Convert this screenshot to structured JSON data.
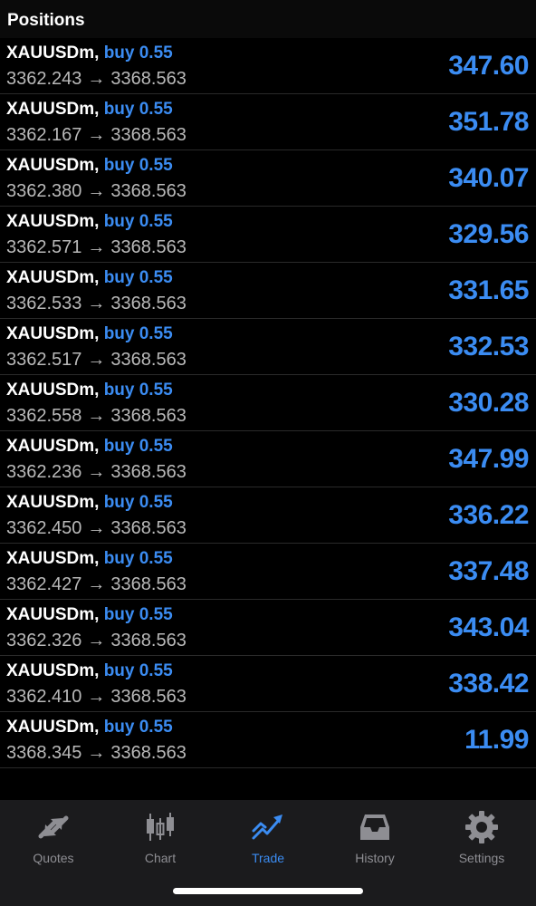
{
  "header": {
    "title": "Positions"
  },
  "positions": [
    {
      "symbol": "XAUUSDm",
      "side": "buy 0.55",
      "open_price": "3362.243",
      "arrow": "→",
      "current_price": "3368.563",
      "profit": "347.60"
    },
    {
      "symbol": "XAUUSDm",
      "side": "buy 0.55",
      "open_price": "3362.167",
      "arrow": "→",
      "current_price": "3368.563",
      "profit": "351.78"
    },
    {
      "symbol": "XAUUSDm",
      "side": "buy 0.55",
      "open_price": "3362.380",
      "arrow": "→",
      "current_price": "3368.563",
      "profit": "340.07"
    },
    {
      "symbol": "XAUUSDm",
      "side": "buy 0.55",
      "open_price": "3362.571",
      "arrow": "→",
      "current_price": "3368.563",
      "profit": "329.56"
    },
    {
      "symbol": "XAUUSDm",
      "side": "buy 0.55",
      "open_price": "3362.533",
      "arrow": "→",
      "current_price": "3368.563",
      "profit": "331.65"
    },
    {
      "symbol": "XAUUSDm",
      "side": "buy 0.55",
      "open_price": "3362.517",
      "arrow": "→",
      "current_price": "3368.563",
      "profit": "332.53"
    },
    {
      "symbol": "XAUUSDm",
      "side": "buy 0.55",
      "open_price": "3362.558",
      "arrow": "→",
      "current_price": "3368.563",
      "profit": "330.28"
    },
    {
      "symbol": "XAUUSDm",
      "side": "buy 0.55",
      "open_price": "3362.236",
      "arrow": "→",
      "current_price": "3368.563",
      "profit": "347.99"
    },
    {
      "symbol": "XAUUSDm",
      "side": "buy 0.55",
      "open_price": "3362.450",
      "arrow": "→",
      "current_price": "3368.563",
      "profit": "336.22"
    },
    {
      "symbol": "XAUUSDm",
      "side": "buy 0.55",
      "open_price": "3362.427",
      "arrow": "→",
      "current_price": "3368.563",
      "profit": "337.48"
    },
    {
      "symbol": "XAUUSDm",
      "side": "buy 0.55",
      "open_price": "3362.326",
      "arrow": "→",
      "current_price": "3368.563",
      "profit": "343.04"
    },
    {
      "symbol": "XAUUSDm",
      "side": "buy 0.55",
      "open_price": "3362.410",
      "arrow": "→",
      "current_price": "3368.563",
      "profit": "338.42"
    },
    {
      "symbol": "XAUUSDm",
      "side": "buy 0.55",
      "open_price": "3368.345",
      "arrow": "→",
      "current_price": "3368.563",
      "profit": "11.99"
    }
  ],
  "tabs": [
    {
      "label": "Quotes",
      "icon": "quotes-icon",
      "active": false
    },
    {
      "label": "Chart",
      "icon": "chart-candles-icon",
      "active": false
    },
    {
      "label": "Trade",
      "icon": "trade-trend-icon",
      "active": true
    },
    {
      "label": "History",
      "icon": "history-inbox-icon",
      "active": false
    },
    {
      "label": "Settings",
      "icon": "gear-icon",
      "active": false
    }
  ],
  "colors": {
    "accent": "#3b8cf2",
    "background": "#000000",
    "secondary_text": "#b9b9b9",
    "tab_bar": "#1b1b1d",
    "inactive_tab": "#8e8e93"
  }
}
